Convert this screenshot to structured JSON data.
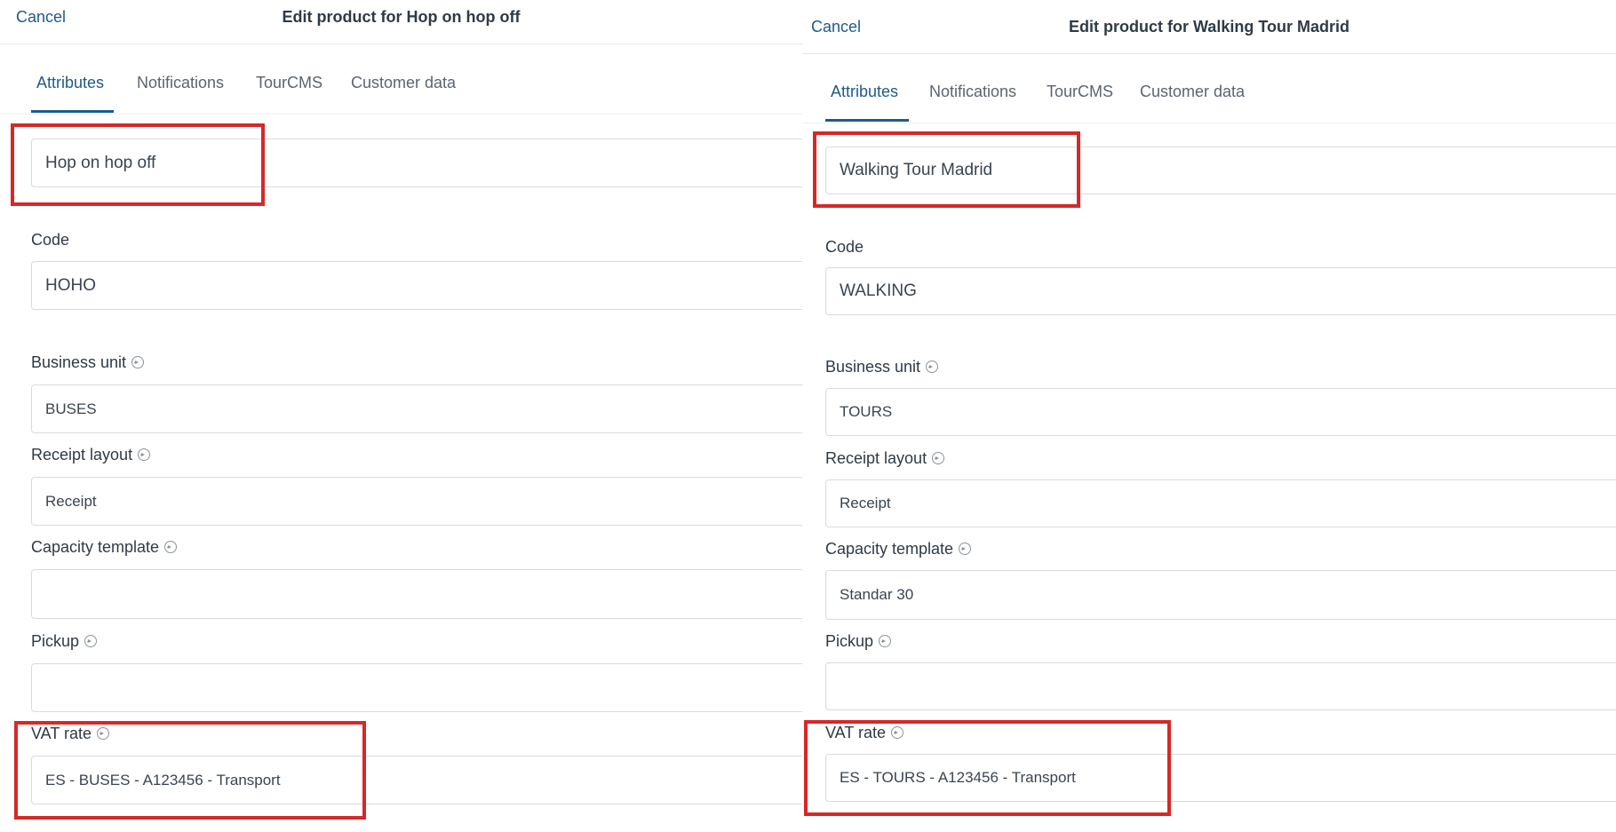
{
  "left": {
    "cancel_label": "Cancel",
    "title": "Edit product for Hop on hop off",
    "tabs": [
      "Attributes",
      "Notifications",
      "TourCMS",
      "Customer data"
    ],
    "name_value": "Hop on hop off",
    "code_label": "Code",
    "code_value": "HOHO",
    "business_unit_label": "Business unit",
    "business_unit_value": "BUSES",
    "receipt_layout_label": "Receipt layout",
    "receipt_layout_value": "Receipt",
    "capacity_template_label": "Capacity template",
    "capacity_template_value": "",
    "pickup_label": "Pickup",
    "pickup_value": "",
    "vat_rate_label": "VAT rate",
    "vat_rate_value": "ES - BUSES - A123456 - Transport"
  },
  "right": {
    "cancel_label": "Cancel",
    "title": "Edit product for Walking Tour Madrid",
    "tabs": [
      "Attributes",
      "Notifications",
      "TourCMS",
      "Customer data"
    ],
    "name_value": "Walking Tour Madrid",
    "code_label": "Code",
    "code_value": "WALKING",
    "business_unit_label": "Business unit",
    "business_unit_value": "TOURS",
    "receipt_layout_label": "Receipt layout",
    "receipt_layout_value": "Receipt",
    "capacity_template_label": "Capacity template",
    "capacity_template_value": "Standar 30",
    "pickup_label": "Pickup",
    "pickup_value": "",
    "vat_rate_label": "VAT rate",
    "vat_rate_value": "ES - TOURS - A123456 - Transport"
  },
  "colors": {
    "accent": "#1f5a8a",
    "highlight": "#d62828"
  },
  "icons": {
    "field_info": "arrow-circle-right-icon"
  }
}
